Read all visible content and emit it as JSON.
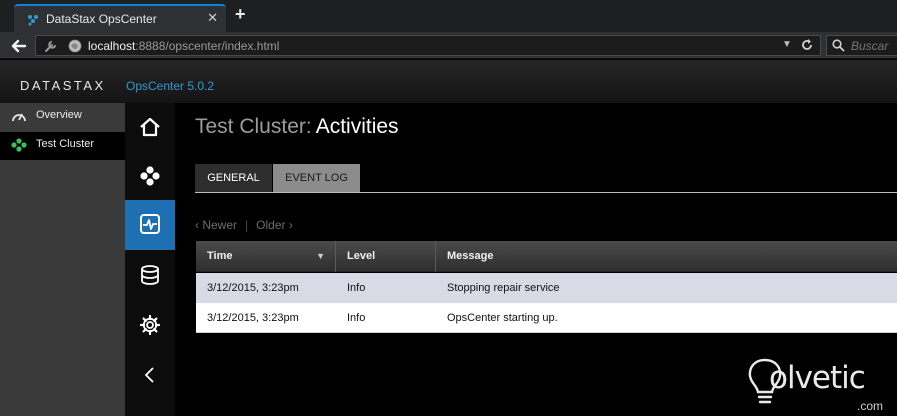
{
  "browser": {
    "tab_title": "DataStax OpsCenter",
    "tab_close": "✕",
    "new_tab": "+",
    "url_host": "localhost",
    "url_rest": ":8888/opscenter/index.html",
    "search_placeholder": "Buscar"
  },
  "app": {
    "logo": "DATASTAX",
    "product_version": "OpsCenter 5.0.2",
    "accent_color": "#2f9bd4"
  },
  "leftnav": {
    "items": [
      {
        "label": "Overview",
        "icon": "gauge-icon"
      },
      {
        "label": "Test Cluster",
        "icon": "cluster-icon",
        "active": true
      }
    ]
  },
  "rail": {
    "items": [
      {
        "icon": "home-icon"
      },
      {
        "icon": "nodes-icon"
      },
      {
        "icon": "activity-icon",
        "active": true
      },
      {
        "icon": "database-icon"
      },
      {
        "icon": "gear-icon"
      },
      {
        "icon": "chevron-left-icon"
      }
    ]
  },
  "page": {
    "cluster_name": "Test Cluster:",
    "section": "Activities",
    "tabs": [
      {
        "label": "GENERAL",
        "active": true
      },
      {
        "label": "EVENT LOG",
        "active": false
      }
    ],
    "pager": {
      "newer": "‹ Newer",
      "separator": "|",
      "older": "Older ›"
    }
  },
  "grid": {
    "columns": {
      "time": "Time",
      "level": "Level",
      "message": "Message"
    },
    "sort_indicator": "▼",
    "rows": [
      {
        "time": "3/12/2015, 3:23pm",
        "level": "Info",
        "message": "Stopping repair service"
      },
      {
        "time": "3/12/2015, 3:23pm",
        "level": "Info",
        "message": "OpsCenter starting up."
      }
    ]
  },
  "watermark": {
    "text": "olvetic",
    "suffix": ".com"
  }
}
